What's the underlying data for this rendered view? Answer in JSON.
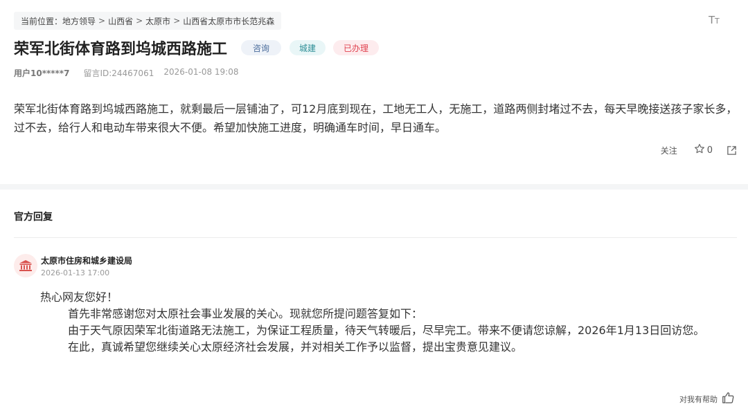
{
  "breadcrumb": {
    "prefix": "当前位置：",
    "items": [
      "地方领导",
      "山西省",
      "太原市",
      "山西省太原市市长范兆森"
    ],
    "separator": ">"
  },
  "font_toggle_label": "TT",
  "post": {
    "title": "荣军北街体育路到坞城西路施工",
    "tags": {
      "consult": "咨询",
      "category": "城建",
      "status": "已办理"
    },
    "user": "用户10*****7",
    "message_id": "留言ID:24467061",
    "datetime": "2026-01-08 19:08",
    "content": "荣军北街体育路到坞城西路施工，就剩最后一层铺油了，可12月底到现在，工地无工人，无施工，道路两侧封堵过不去，每天早晚接送孩子家长多，过不去，给行人和电动车带来很大不便。希望加快施工进度，明确通车时间，早日通车。",
    "actions": {
      "follow_label": "关注",
      "like_count": "0"
    }
  },
  "reply": {
    "heading": "官方回复",
    "org_name": "太原市住房和城乡建设局",
    "datetime": "2026-01-13 17:00",
    "greeting": "热心网友您好！",
    "paragraphs": [
      "首先非常感谢您对太原社会事业发展的关心。现就您所提问题答复如下：",
      "由于天气原因荣军北街道路无法施工，为保证工程质量，待天气转暖后，尽早完工。带来不便请您谅解，2026年1月13日回访您。",
      "在此，真诚希望您继续关心太原经济社会发展，并对相关工作予以监督，提出宝贵意见建议。"
    ],
    "helpful_label": "对我有帮助"
  },
  "colors": {
    "tag_consult_bg": "#eef2f8",
    "tag_city_bg": "#e9f6f7",
    "tag_done_bg": "#fdecee",
    "status_red": "#e0424f",
    "avatar_red": "#d9534f"
  },
  "icons": [
    "font-size-icon",
    "star-icon",
    "share-icon",
    "government-building-icon",
    "thumbs-up-icon"
  ]
}
